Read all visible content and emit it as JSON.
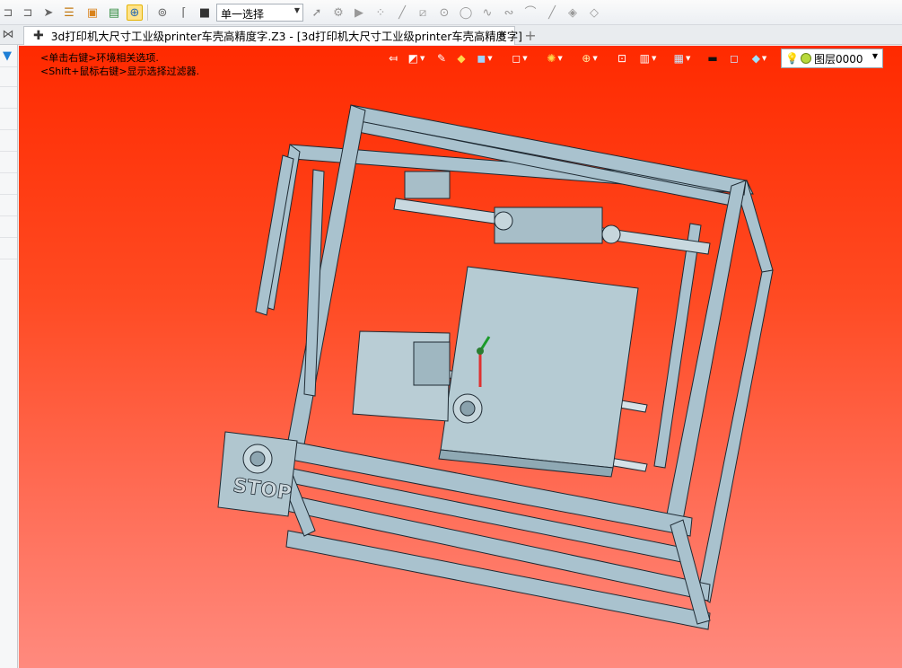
{
  "toolbar": {
    "select_mode": "单一选择",
    "icons": [
      "pick-icon",
      "filter-pick-icon",
      "cursor-icon",
      "list-icon",
      "folder-icon",
      "layer-icon",
      "select-highlight-icon",
      "rotate-icon",
      "bracket-icon",
      "stop-icon"
    ],
    "geometry_icons": [
      "select-arrow-icon",
      "gear-icon",
      "play-icon",
      "points-icon",
      "line-icon",
      "line-segment-icon",
      "circle-center-icon",
      "circle-icon",
      "spline-icon",
      "curve-icon",
      "arc-icon",
      "tangent-line-icon",
      "surface-icon",
      "surface2-icon"
    ]
  },
  "tabs": {
    "document_title": "3d打印机大尺寸工业级printer车壳高精度字.Z3 - [3d打印机大尺寸工业级printer车壳高精度字]",
    "close": "✕",
    "new_tab": "+"
  },
  "viewport": {
    "hint_line1": "<单击右键>环境相关选项.",
    "hint_line2": "<Shift+鼠标右键>显示选择过滤器.",
    "layer": "图层0000",
    "model_label": "STOP",
    "background_top": "#ff2a00",
    "background_bottom": "#ff8a7e"
  }
}
